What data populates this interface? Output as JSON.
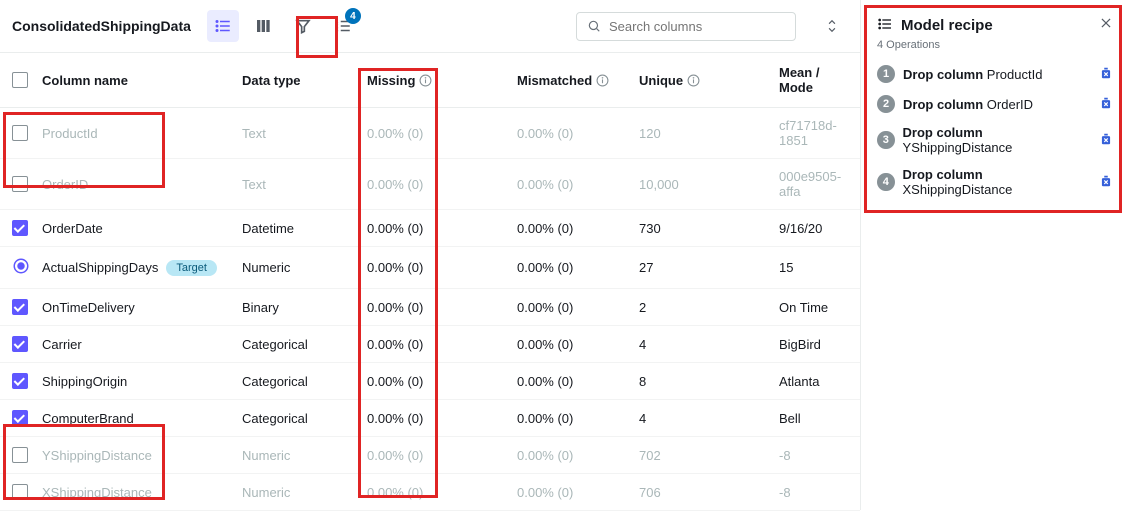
{
  "toolbar": {
    "dataset_title": "ConsolidatedShippingData",
    "recipe_badge": "4",
    "search_placeholder": "Search columns"
  },
  "headers": {
    "name": "Column name",
    "type": "Data type",
    "missing": "Missing",
    "mismatched": "Mismatched",
    "unique": "Unique",
    "mean": "Mean / Mode"
  },
  "rows": [
    {
      "name": "ProductId",
      "type": "Text",
      "missing": "0.00% (0)",
      "mismatched": "0.00% (0)",
      "unique": "120",
      "mean": "cf71718d-1851",
      "checked": false,
      "dropped": true,
      "target": false
    },
    {
      "name": "OrderID",
      "type": "Text",
      "missing": "0.00% (0)",
      "mismatched": "0.00% (0)",
      "unique": "10,000",
      "mean": "000e9505-affa",
      "checked": false,
      "dropped": true,
      "target": false
    },
    {
      "name": "OrderDate",
      "type": "Datetime",
      "missing": "0.00% (0)",
      "mismatched": "0.00% (0)",
      "unique": "730",
      "mean": "9/16/20",
      "checked": true,
      "dropped": false,
      "target": false
    },
    {
      "name": "ActualShippingDays",
      "type": "Numeric",
      "missing": "0.00% (0)",
      "mismatched": "0.00% (0)",
      "unique": "27",
      "mean": "15",
      "checked": null,
      "dropped": false,
      "target": true,
      "target_label": "Target"
    },
    {
      "name": "OnTimeDelivery",
      "type": "Binary",
      "missing": "0.00% (0)",
      "mismatched": "0.00% (0)",
      "unique": "2",
      "mean": "On Time",
      "checked": true,
      "dropped": false,
      "target": false
    },
    {
      "name": "Carrier",
      "type": "Categorical",
      "missing": "0.00% (0)",
      "mismatched": "0.00% (0)",
      "unique": "4",
      "mean": "BigBird",
      "checked": true,
      "dropped": false,
      "target": false
    },
    {
      "name": "ShippingOrigin",
      "type": "Categorical",
      "missing": "0.00% (0)",
      "mismatched": "0.00% (0)",
      "unique": "8",
      "mean": "Atlanta",
      "checked": true,
      "dropped": false,
      "target": false
    },
    {
      "name": "ComputerBrand",
      "type": "Categorical",
      "missing": "0.00% (0)",
      "mismatched": "0.00% (0)",
      "unique": "4",
      "mean": "Bell",
      "checked": true,
      "dropped": false,
      "target": false
    },
    {
      "name": "YShippingDistance",
      "type": "Numeric",
      "missing": "0.00% (0)",
      "mismatched": "0.00% (0)",
      "unique": "702",
      "mean": "-8",
      "checked": false,
      "dropped": true,
      "target": false
    },
    {
      "name": "XShippingDistance",
      "type": "Numeric",
      "missing": "0.00% (0)",
      "mismatched": "0.00% (0)",
      "unique": "706",
      "mean": "-8",
      "checked": false,
      "dropped": true,
      "target": false
    }
  ],
  "recipe": {
    "title": "Model recipe",
    "subtitle": "4 Operations",
    "ops": [
      {
        "n": "1",
        "cmd": "Drop column",
        "arg": "ProductId"
      },
      {
        "n": "2",
        "cmd": "Drop column",
        "arg": "OrderID"
      },
      {
        "n": "3",
        "cmd": "Drop column",
        "arg": "YShippingDistance"
      },
      {
        "n": "4",
        "cmd": "Drop column",
        "arg": "XShippingDistance"
      }
    ]
  }
}
